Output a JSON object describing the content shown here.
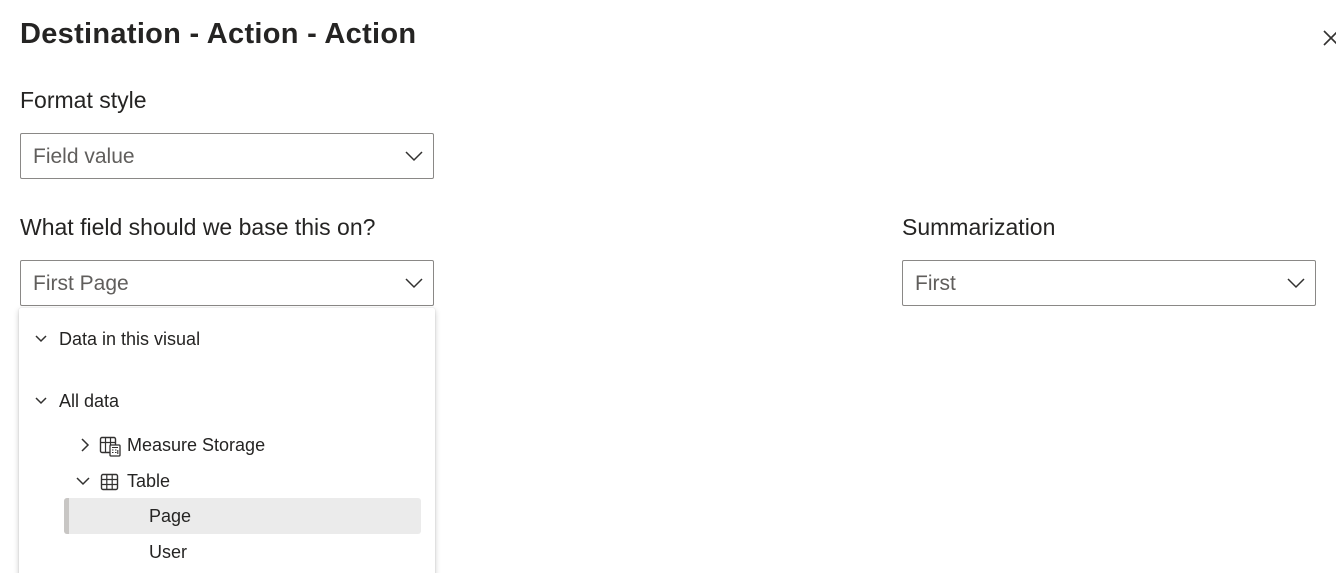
{
  "dialog": {
    "title": "Destination - Action - Action"
  },
  "format_style": {
    "label": "Format style",
    "value": "Field value"
  },
  "base_field": {
    "label": "What field should we base this on?",
    "value": "First Page"
  },
  "summarization": {
    "label": "Summarization",
    "value": "First"
  },
  "field_tree": {
    "data_in_visual": "Data in this visual",
    "all_data": "All data",
    "tables": [
      {
        "label": "Measure Storage",
        "expanded": false,
        "icon": "measure-table-icon"
      },
      {
        "label": "Table",
        "expanded": true,
        "icon": "table-icon"
      }
    ],
    "fields": [
      {
        "label": "Page",
        "selected": true
      },
      {
        "label": "User",
        "selected": false
      }
    ]
  },
  "colors": {
    "text": "#252423",
    "muted_text": "#605e5c",
    "border": "#8a8886",
    "selected_row": "#ebebeb"
  }
}
